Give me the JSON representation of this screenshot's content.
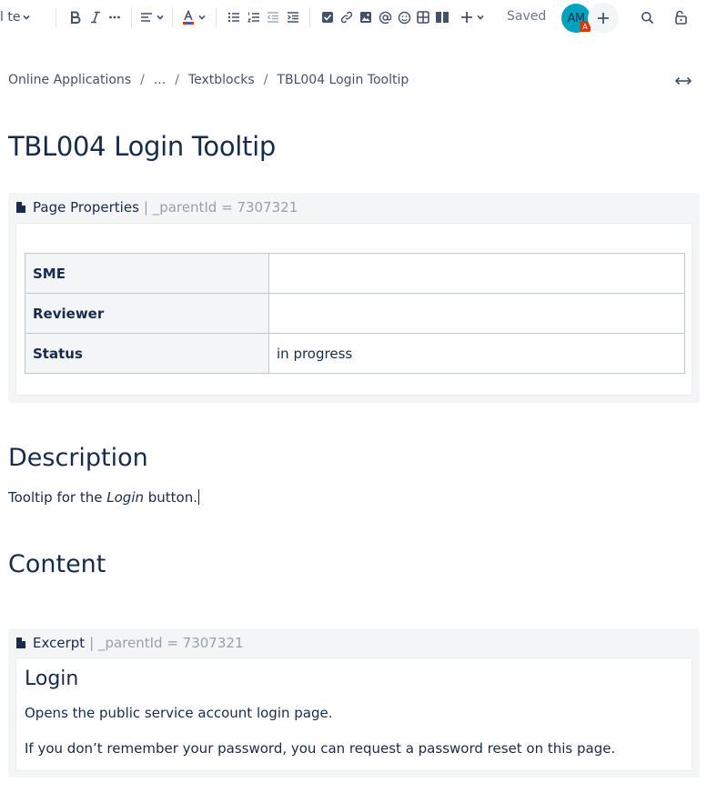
{
  "toolbar": {
    "text_style_label": "l te",
    "saved_label": "Saved",
    "avatar_initials": "AM",
    "avatar_badge": "A"
  },
  "breadcrumb": {
    "items": [
      "Online Applications",
      "...",
      "Textblocks",
      "TBL004 Login Tooltip"
    ]
  },
  "page": {
    "title": "TBL004 Login Tooltip"
  },
  "page_properties": {
    "macro_name": "Page Properties",
    "param": "| _parentId = 7307321",
    "rows": [
      {
        "label": "SME",
        "value": ""
      },
      {
        "label": "Reviewer",
        "value": ""
      },
      {
        "label": "Status",
        "value": "in progress"
      }
    ]
  },
  "description": {
    "heading": "Description",
    "text_before": "Tooltip for the ",
    "text_em": "Login",
    "text_after": " button."
  },
  "content": {
    "heading": "Content"
  },
  "excerpt": {
    "macro_name": "Excerpt",
    "param": "| _parentId = 7307321",
    "title": "Login",
    "paragraph1": "Opens the public service account login page.",
    "paragraph2": "If you don’t remember your password, you can request a password reset on this page."
  },
  "colors": {
    "text": "#172b4d",
    "muted": "#6b778c",
    "macro_bg": "#f4f5f7",
    "avatar_bg": "#00a3bf",
    "badge_bg": "#de350b"
  }
}
